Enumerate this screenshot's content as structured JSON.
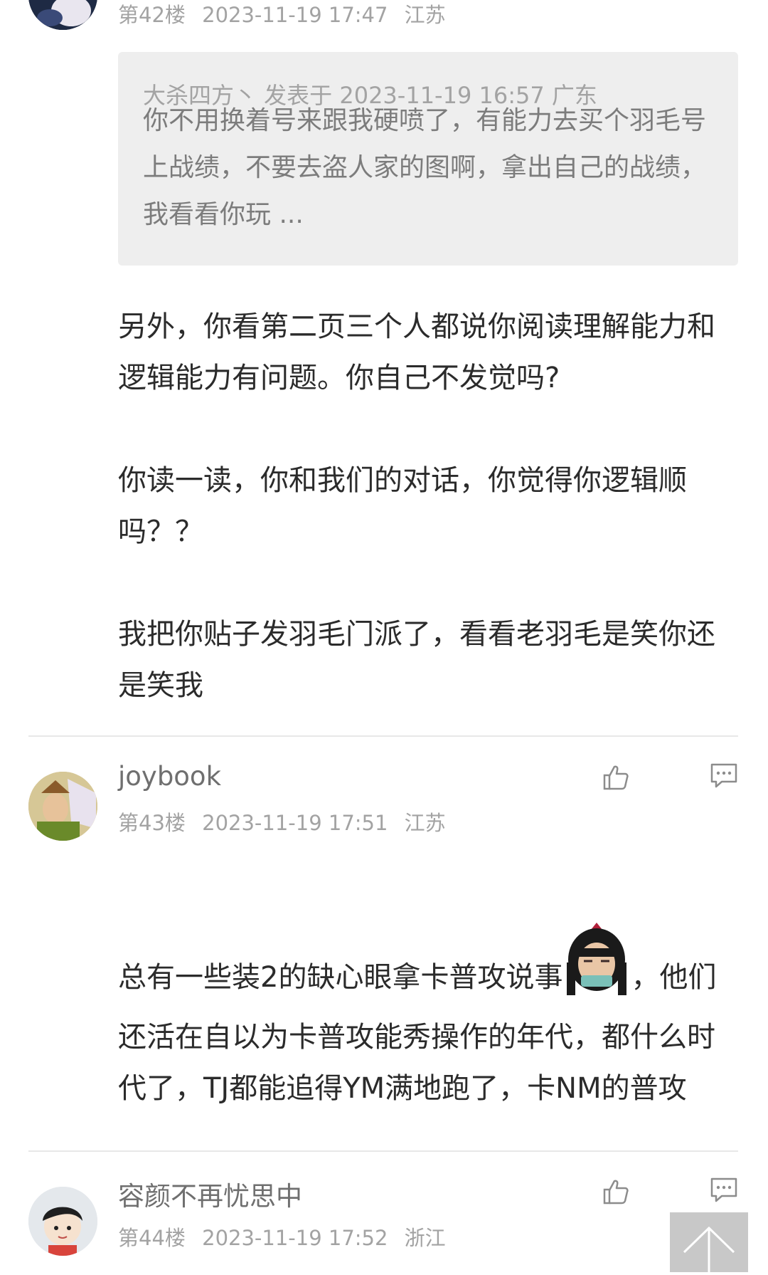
{
  "post42": {
    "floor": "第42楼",
    "time": "2023-11-19 17:47",
    "location": "江苏",
    "quote": {
      "meta": "大杀四方丶 发表于 2023-11-19 16:57 广东",
      "text": "你不用换着号来跟我硬喷了，有能力去买个羽毛号上战绩，不要去盗人家的图啊，拿出自己的战绩，我看看你玩 ..."
    },
    "paragraphs": [
      "另外，你看第二页三个人都说你阅读理解能力和逻辑能力有问题。你自己不发觉吗?",
      "你读一读，你和我们的对话，你觉得你逻辑顺吗？？",
      "我把你贴子发羽毛门派了，看看老羽毛是笑你还是笑我"
    ]
  },
  "post43": {
    "username": "joybook",
    "floor": "第43楼",
    "time": "2023-11-19 17:51",
    "location": "江苏",
    "text_before_sticker": "总有一些装2的缺心眼拿卡普攻说事",
    "text_after_sticker": "，他们还活在自以为卡普攻能秀操作的年代，都什么时代了，TJ都能追得YM满地跑了，卡NM的普攻"
  },
  "post44": {
    "username": "容颜不再忧思中",
    "floor": "第44楼",
    "time": "2023-11-19 17:52",
    "location": "浙江"
  },
  "icons": {
    "like": "thumbs-up-icon",
    "reply": "comment-icon",
    "back_to_top": "arrow-up-icon"
  },
  "colors": {
    "text": "#2b2b2b",
    "meta": "#a3a3a3",
    "quote_bg": "#eeeeee",
    "divider": "#e8e8e8"
  }
}
